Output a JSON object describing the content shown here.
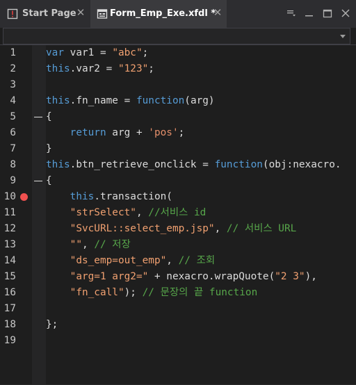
{
  "tabs": [
    {
      "label": "Start Page",
      "icon": "start-page-icon",
      "active": false
    },
    {
      "label": "Form_Emp_Exe.xfdl *",
      "icon": "form-file-icon",
      "active": true
    }
  ],
  "window_controls": [
    "dropdown-menu-icon",
    "minimize-icon",
    "maximize-icon",
    "close-icon"
  ],
  "selector": {
    "value": ""
  },
  "colors": {
    "keyword": "#569cd6",
    "string": "#f0a070",
    "comment": "#57a64a",
    "breakpoint": "#f0504f"
  },
  "lines": [
    {
      "n": "1",
      "tokens": [
        [
          "kw",
          "var"
        ],
        [
          "pl",
          " var1 = "
        ],
        [
          "str",
          "\"abc\""
        ],
        [
          "pl",
          ";"
        ]
      ]
    },
    {
      "n": "2",
      "tokens": [
        [
          "kw",
          "this"
        ],
        [
          "pl",
          ".var2 = "
        ],
        [
          "str",
          "\"123\""
        ],
        [
          "pl",
          ";"
        ]
      ]
    },
    {
      "n": "3",
      "tokens": []
    },
    {
      "n": "4",
      "tokens": [
        [
          "kw",
          "this"
        ],
        [
          "pl",
          ".fn_name = "
        ],
        [
          "kw",
          "function"
        ],
        [
          "pl",
          "(arg)"
        ]
      ]
    },
    {
      "n": "5",
      "tokens": [
        [
          "pl",
          "{"
        ]
      ],
      "fold": true
    },
    {
      "n": "6",
      "tokens": [
        [
          "pl",
          "    "
        ],
        [
          "kw",
          "return"
        ],
        [
          "pl",
          " arg + "
        ],
        [
          "sq",
          "'pos'"
        ],
        [
          "pl",
          ";"
        ]
      ]
    },
    {
      "n": "7",
      "tokens": [
        [
          "pl",
          "}"
        ]
      ]
    },
    {
      "n": "8",
      "tokens": [
        [
          "kw",
          "this"
        ],
        [
          "pl",
          ".btn_retrieve_onclick = "
        ],
        [
          "kw",
          "function"
        ],
        [
          "pl",
          "(obj:nexacro."
        ]
      ]
    },
    {
      "n": "9",
      "tokens": [
        [
          "pl",
          "{"
        ]
      ],
      "fold": true
    },
    {
      "n": "10",
      "tokens": [
        [
          "pl",
          "    "
        ],
        [
          "kw",
          "this"
        ],
        [
          "pl",
          ".transaction("
        ]
      ],
      "breakpoint": true
    },
    {
      "n": "11",
      "tokens": [
        [
          "pl",
          "    "
        ],
        [
          "str",
          "\"strSelect\""
        ],
        [
          "pl",
          ", "
        ],
        [
          "cmt",
          "//서비스 id"
        ]
      ]
    },
    {
      "n": "12",
      "tokens": [
        [
          "pl",
          "    "
        ],
        [
          "str",
          "\"SvcURL::select_emp.jsp\""
        ],
        [
          "pl",
          ", "
        ],
        [
          "cmt",
          "// 서비스 URL"
        ]
      ]
    },
    {
      "n": "13",
      "tokens": [
        [
          "pl",
          "    "
        ],
        [
          "str",
          "\"\""
        ],
        [
          "pl",
          ", "
        ],
        [
          "cmt",
          "// 저장"
        ]
      ]
    },
    {
      "n": "14",
      "tokens": [
        [
          "pl",
          "    "
        ],
        [
          "str",
          "\"ds_emp=out_emp\""
        ],
        [
          "pl",
          ", "
        ],
        [
          "cmt",
          "// 조회"
        ]
      ]
    },
    {
      "n": "15",
      "tokens": [
        [
          "pl",
          "    "
        ],
        [
          "str",
          "\"arg=1 arg2=\""
        ],
        [
          "pl",
          " + nexacro.wrapQuote("
        ],
        [
          "str",
          "\"2 3\""
        ],
        [
          "pl",
          "),"
        ]
      ]
    },
    {
      "n": "16",
      "tokens": [
        [
          "pl",
          "    "
        ],
        [
          "str",
          "\"fn_call\""
        ],
        [
          "pl",
          "); "
        ],
        [
          "cmt",
          "// 문장의 끝 function"
        ]
      ]
    },
    {
      "n": "17",
      "tokens": []
    },
    {
      "n": "18",
      "tokens": [
        [
          "pl",
          "};"
        ]
      ]
    },
    {
      "n": "19",
      "tokens": []
    }
  ]
}
